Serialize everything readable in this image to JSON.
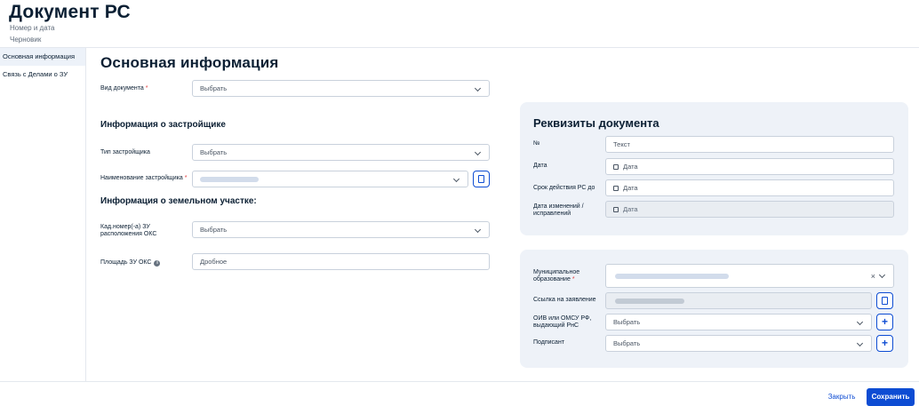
{
  "header": {
    "title": "Документ РС",
    "subtitle_number": "Номер и дата",
    "status": "Черновик"
  },
  "sidebar": {
    "items": [
      {
        "label": "Основная информация",
        "active": true
      },
      {
        "label": "Связь с Делами о ЗУ",
        "active": false
      }
    ]
  },
  "main": {
    "title": "Основная информация",
    "doc_type": {
      "label": "Вид документа",
      "value": "Выбрать"
    },
    "developer_section": "Информация о застройщике",
    "developer_type": {
      "label": "Тип застройщика",
      "value": "Выбрать"
    },
    "developer_name": {
      "label": "Наименование застройщика"
    },
    "land_section": "Информация о земельном участке:",
    "cadastral": {
      "label": "Кад.номер(-а) ЗУ расположения ОКС",
      "value": "Выбрать"
    },
    "area": {
      "label": "Площадь ЗУ ОКС",
      "placeholder": "Дробное",
      "info_icon": "i"
    }
  },
  "requisites": {
    "title": "Реквизиты документа",
    "number": {
      "label": "№",
      "placeholder": "Текст"
    },
    "date": {
      "label": "Дата",
      "placeholder": "Дата"
    },
    "valid_until": {
      "label": "Срок действия РС до",
      "placeholder": "Дата"
    },
    "change_date": {
      "label": "Дата изменений / исправлений",
      "placeholder": "Дата"
    }
  },
  "extra": {
    "municipality": {
      "label": "Муниципальное образование"
    },
    "application_link": {
      "label": "Ссылка на заявление"
    },
    "authority": {
      "label": "ОИВ или ОМСУ РФ, выдающий РнС",
      "value": "Выбрать"
    },
    "signer": {
      "label": "Подписант",
      "value": "Выбрать"
    }
  },
  "footer": {
    "close_label": "Закрыть",
    "save_label": "Сохранить"
  },
  "colors": {
    "accent": "#0d4cd3",
    "card_bg": "#eef2f8",
    "required": "#e03a3a"
  },
  "icons": {
    "calendar": "calendar-icon",
    "document": "document-icon",
    "plus": "plus-icon",
    "chevron": "chevron-down-icon",
    "clear": "close-icon",
    "info": "info-icon"
  },
  "required_mark": "*",
  "clear_glyph": "×",
  "plus_glyph": "+"
}
